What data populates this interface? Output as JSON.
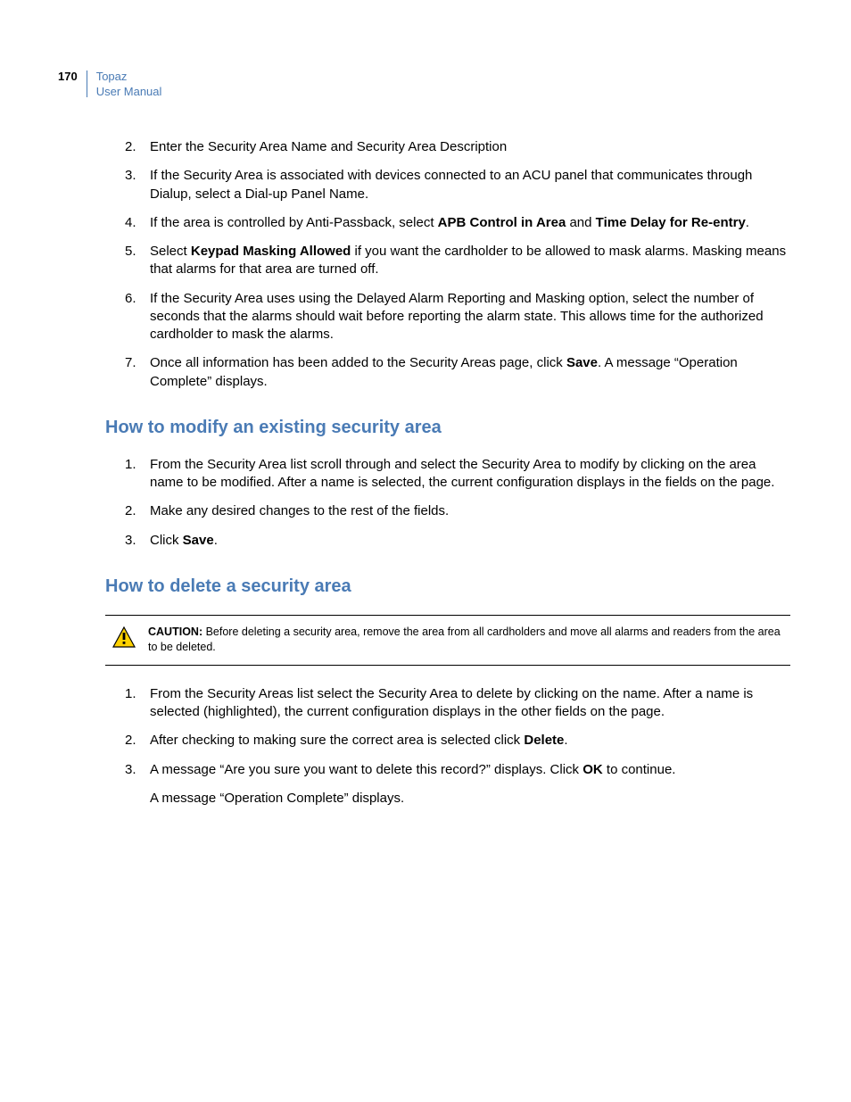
{
  "header": {
    "page_number": "170",
    "title_line1": "Topaz",
    "title_line2": "User Manual"
  },
  "list1": {
    "item2": {
      "num": "2.",
      "text": "Enter the Security Area Name and Security Area Description"
    },
    "item3": {
      "num": "3.",
      "text": "If the Security Area is associated with devices connected to an ACU panel that communicates through Dialup, select a Dial-up Panel Name."
    },
    "item4": {
      "num": "4.",
      "prefix": "If the area is controlled by Anti-Passback, select ",
      "bold1": "APB Control in Area",
      "mid": " and ",
      "bold2": "Time Delay for Re-entry",
      "suffix": "."
    },
    "item5": {
      "num": "5.",
      "prefix": "Select ",
      "bold1": "Keypad Masking Allowed",
      "suffix": " if you want the cardholder to be allowed to mask alarms. Masking means that alarms for that area are turned off."
    },
    "item6": {
      "num": "6.",
      "text": "If the Security Area uses using the Delayed Alarm Reporting and Masking option, select the number of seconds that the alarms should wait before reporting the alarm state. This allows time for the authorized cardholder to mask the alarms."
    },
    "item7": {
      "num": "7.",
      "prefix": "Once all information has been added to the Security Areas page, click ",
      "bold1": "Save",
      "suffix": ". A message “Operation Complete” displays."
    }
  },
  "heading1": "How to modify an existing security area",
  "list2": {
    "item1": {
      "num": "1.",
      "text": "From the Security Area list scroll through and select the Security Area to modify by clicking on the area name to be modified. After a name is selected, the current configuration displays in the fields on the page."
    },
    "item2": {
      "num": "2.",
      "text": "Make any desired changes to the rest of the fields."
    },
    "item3": {
      "num": "3.",
      "prefix": "Click ",
      "bold1": "Save",
      "suffix": "."
    }
  },
  "heading2": "How to delete a security area",
  "caution": {
    "label": "CAUTION:",
    "text": "  Before deleting a security area, remove the area from all cardholders and move all alarms and readers from the area to be deleted."
  },
  "list3": {
    "item1": {
      "num": "1.",
      "text": "From the Security Areas list select the Security Area to delete by clicking on the name. After a name is selected (highlighted), the current configuration displays in the other fields on the page."
    },
    "item2": {
      "num": "2.",
      "prefix": "After checking to making sure the correct area is selected click ",
      "bold1": "Delete",
      "suffix": "."
    },
    "item3": {
      "num": "3.",
      "prefix": "A message “Are you sure you want to delete this record?” displays. Click ",
      "bold1": "OK",
      "suffix": " to continue."
    },
    "followup": "A message “Operation Complete” displays."
  }
}
